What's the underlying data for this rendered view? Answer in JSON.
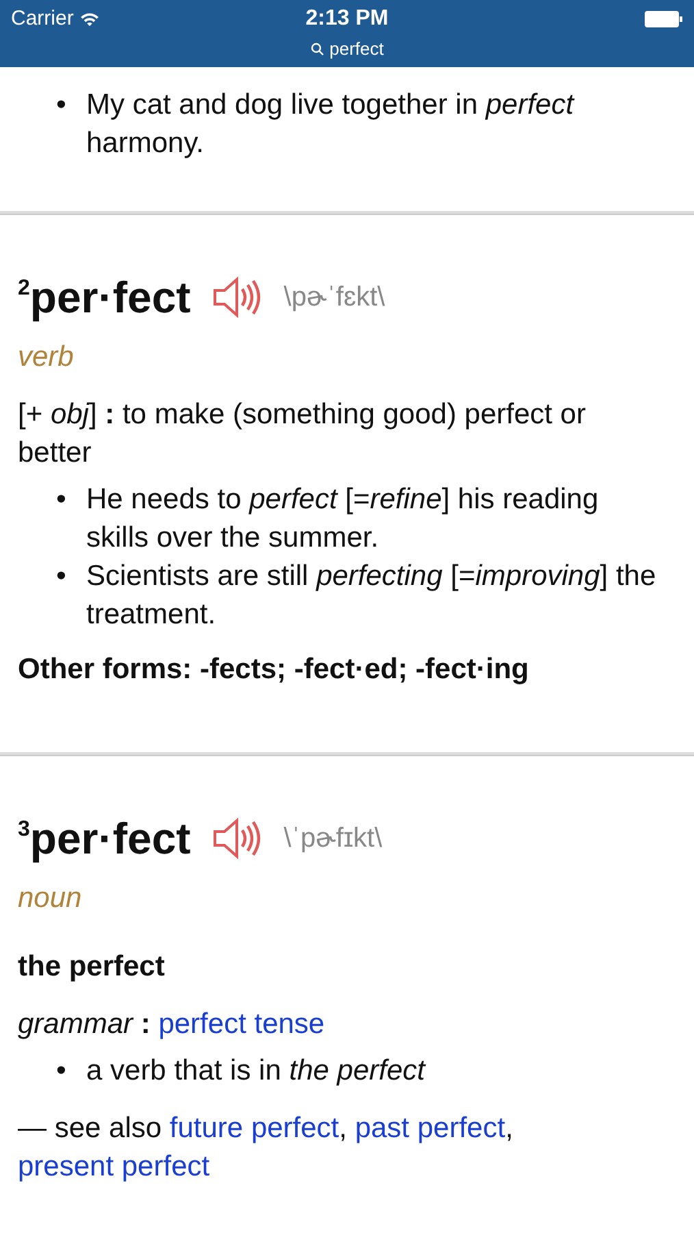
{
  "status_bar": {
    "carrier": "Carrier",
    "time": "2:13 PM"
  },
  "search": {
    "query": "perfect"
  },
  "sections": [
    {
      "blocks": [
        {
          "kind": "examples",
          "bullet": "•",
          "items": [
            "My cat and dog live together in *perfect* harmony."
          ]
        }
      ]
    },
    {
      "homograph": "2",
      "headword": "per·fect",
      "pronunciation": "\\pɚˈfɛkt\\",
      "part_of_speech": "verb",
      "blocks": [
        {
          "kind": "definition",
          "text": "[+ *obj*] **:** to make (something good) perfect or better"
        },
        {
          "kind": "examples",
          "bullet": "•",
          "items": [
            "He needs to *perfect* [=*refine*] his reading skills over the summer.",
            "Scientists are still *perfecting* [=*improving*] the treatment."
          ]
        },
        {
          "kind": "forms",
          "text": "Other forms: -fects; -fect·ed; -fect·ing"
        }
      ]
    },
    {
      "homograph": "3",
      "headword": "per·fect",
      "pronunciation": "\\ˈpɚfɪkt\\",
      "part_of_speech": "noun",
      "blocks": [
        {
          "kind": "phrase",
          "text": "the perfect"
        },
        {
          "kind": "subject",
          "label": "grammar",
          "separator": ":",
          "links": [
            "perfect tense"
          ]
        },
        {
          "kind": "examples",
          "bullet": "•",
          "items": [
            "a verb that is in *the perfect*"
          ]
        },
        {
          "kind": "see_also",
          "lead": "— see also",
          "separator": ",",
          "links": [
            "future perfect",
            "past perfect",
            "present perfect"
          ]
        }
      ]
    }
  ]
}
